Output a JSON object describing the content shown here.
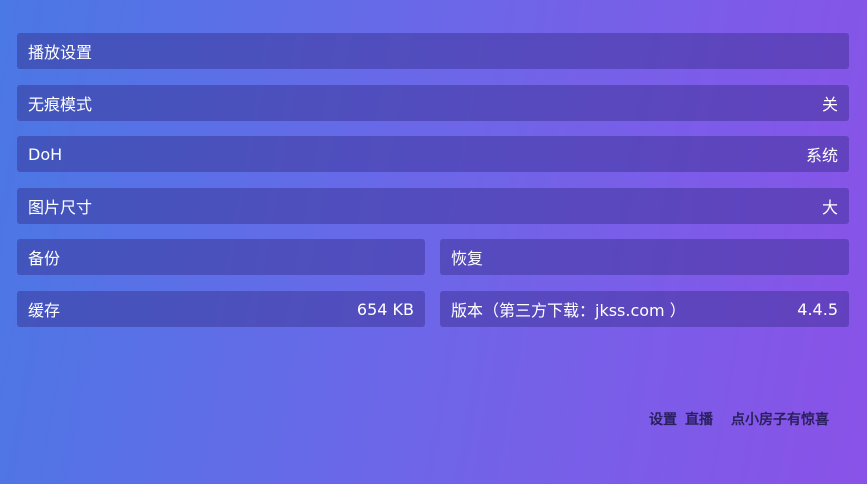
{
  "settings": {
    "playback": {
      "label": "播放设置"
    },
    "incognito": {
      "label": "无痕模式",
      "value": "关"
    },
    "doh": {
      "label": "DoH",
      "value": "系统"
    },
    "image_size": {
      "label": "图片尺寸",
      "value": "大"
    },
    "backup": {
      "label": "备份"
    },
    "restore": {
      "label": "恢复"
    },
    "cache": {
      "label": "缓存",
      "value": "654 KB"
    },
    "version": {
      "label": "版本（第三方下载：jkss.com ）",
      "value": "4.4.5"
    }
  },
  "footer": {
    "settings_link": "设置",
    "live_link": "直播",
    "hint": "点小房子有惊喜"
  }
}
